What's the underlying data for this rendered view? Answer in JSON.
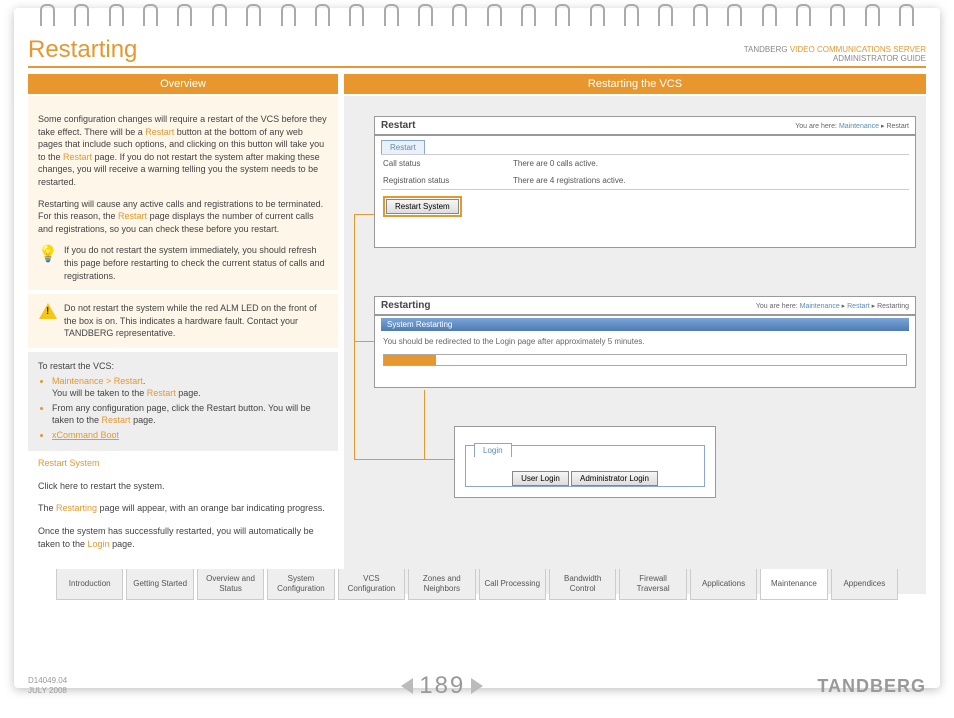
{
  "header": {
    "title": "Restarting",
    "brand": "TANDBERG",
    "product": "VIDEO COMMUNICATIONS SERVER",
    "subtitle": "ADMINISTRATOR GUIDE"
  },
  "banners": {
    "left": "Overview",
    "right": "Restarting the VCS"
  },
  "overview": {
    "para1a": "Some configuration changes will require a restart of the VCS before they take effect.  There will be a ",
    "restart": "Restart",
    "para1b": " button at the bottom of any web pages that include such options, and clicking on this button will take you to the ",
    "para1c": " page. If you do not restart the system after making these changes, you will receive a warning telling you the system needs to be restarted.",
    "para2a": "Restarting will cause any active calls and registrations to be terminated.  For this reason, the ",
    "para2b": " page displays the number of current calls and registrations, so you can check these before you restart.",
    "tip": "If you do not restart the system immediately, you should refresh this page before restarting to check the current status of calls and registrations.",
    "warn": "Do not restart the system while the red ALM LED on the front of the box is on.  This indicates a hardware fault.  Contact your TANDBERG representative.",
    "howto_t": "To restart the VCS:",
    "b1": "Maintenance > Restart",
    "b1b": "You will be taken to the ",
    "b1c": " page.",
    "b2a": "From any configuration page, click the Restart button. You will be taken to the ",
    "b2b": " page.",
    "b3": "xCommand Boot",
    "rs_t": "Restart System",
    "rs1": "Click here to restart the system.",
    "rs2a": "The ",
    "rs2l": "Restarting",
    "rs2b": " page will appear, with an orange bar indicating progress.",
    "rs3a": "Once the system has successfully restarted, you will automatically be taken to the ",
    "rs3l": "Login",
    "rs3b": " page."
  },
  "p1": {
    "title": "Restart",
    "bc_pre": "You are here: ",
    "bc1": "Maintenance",
    "bc2": "Restart",
    "tab": "Restart",
    "k1": "Call status",
    "v1": "There are 0 calls active.",
    "k2": "Registration status",
    "v2": "There are 4 registrations active.",
    "btn": "Restart System"
  },
  "p2": {
    "title": "Restarting",
    "bc_pre": "You are here: ",
    "bc1": "Maintenance",
    "bc2": "Restart",
    "bc3": "Restarting",
    "bar": "System Restarting",
    "msg": "You should be redirected to the Login page after approximately 5 minutes."
  },
  "p3": {
    "tab": "Login",
    "b1": "User Login",
    "b2": "Administrator Login"
  },
  "tabs": [
    "Introduction",
    "Getting Started",
    "Overview and Status",
    "System Configuration",
    "VCS Configuration",
    "Zones and Neighbors",
    "Call Processing",
    "Bandwidth Control",
    "Firewall Traversal",
    "Applications",
    "Maintenance",
    "Appendices"
  ],
  "footer": {
    "doc": "D14049.04",
    "date": "JULY 2008",
    "page": "189",
    "brand": "TANDBERG"
  }
}
